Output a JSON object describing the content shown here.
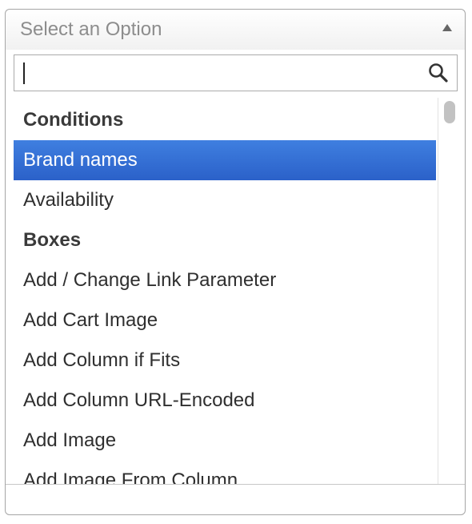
{
  "select": {
    "placeholder": "Select an Option",
    "arrow_icon": "triangle-up-icon"
  },
  "search": {
    "value": "",
    "icon": "search-icon"
  },
  "list": {
    "items": [
      {
        "label": "Conditions",
        "type": "group"
      },
      {
        "label": "Brand names",
        "type": "option",
        "selected": true
      },
      {
        "label": "Availability",
        "type": "option"
      },
      {
        "label": "Boxes",
        "type": "group"
      },
      {
        "label": "Add / Change Link Parameter",
        "type": "option"
      },
      {
        "label": "Add Cart Image",
        "type": "option"
      },
      {
        "label": "Add Column if Fits",
        "type": "option"
      },
      {
        "label": "Add Column URL-Encoded",
        "type": "option"
      },
      {
        "label": "Add Image",
        "type": "option"
      },
      {
        "label": "Add Image From Column",
        "type": "option"
      }
    ]
  },
  "colors": {
    "selected_bg": "#2b61c9",
    "selected_text": "#ffffff",
    "placeholder_text": "#8d8d8d"
  }
}
